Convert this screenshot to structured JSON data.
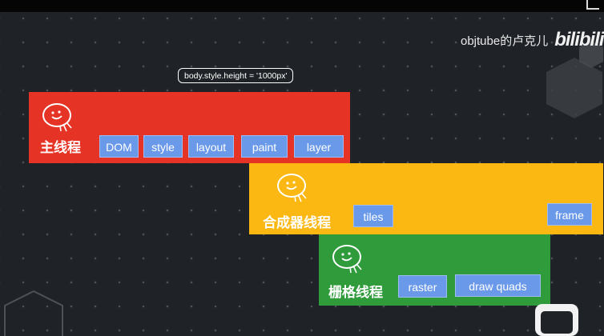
{
  "watermark": {
    "author": "objtube的卢克儿",
    "logo": "bilibili"
  },
  "code_label": "body.style.height =  '1000px'",
  "lanes": {
    "main": {
      "title": "主线程",
      "tasks": [
        "DOM",
        "style",
        "layout",
        "paint",
        "layer"
      ]
    },
    "compositor": {
      "title": "合成器线程",
      "tasks": [
        "tiles",
        "frame"
      ]
    },
    "raster": {
      "title": "栅格线程",
      "tasks": [
        "raster",
        "draw quads"
      ]
    }
  },
  "colors": {
    "background": "#1f2227",
    "main_thread": "#e53325",
    "compositor_thread": "#fcb812",
    "raster_thread": "#2f9b3b",
    "task_chip": "#6a99ea"
  },
  "icons": [
    "smiley-bubble-icon",
    "hexagon-decoration",
    "tv-logo-icon"
  ]
}
